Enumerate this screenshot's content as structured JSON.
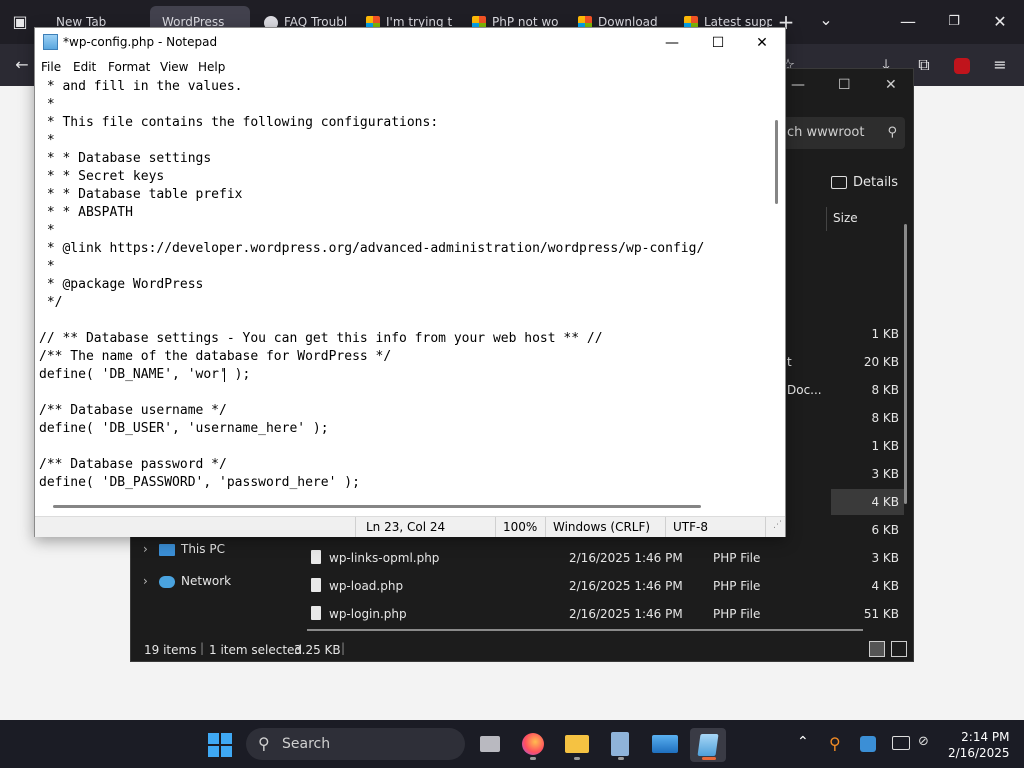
{
  "browser": {
    "tabs": [
      {
        "label": "New Tab",
        "active": false
      },
      {
        "label": "WordPress",
        "active": true
      },
      {
        "label": "FAQ Troubl",
        "active": false
      },
      {
        "label": "I'm trying t",
        "active": false
      },
      {
        "label": "PhP not wo",
        "active": false
      },
      {
        "label": "Download",
        "active": false
      },
      {
        "label": "Latest supp",
        "active": false
      }
    ],
    "new_tab_label": "+",
    "list_tabs_label": "⌄"
  },
  "explorer": {
    "search_placeholder": "ch wwwroot",
    "details_label": "Details",
    "size_header": "Size",
    "partial_names": [
      "t",
      "Doc..."
    ],
    "sizes": [
      "1 KB",
      "20 KB",
      "8 KB",
      "8 KB",
      "1 KB",
      "3 KB",
      "4 KB",
      "6 KB"
    ],
    "nav": [
      {
        "label": "This PC"
      },
      {
        "label": "Network"
      }
    ],
    "files": [
      {
        "name": "wp-links-opml.php",
        "date": "2/16/2025 1:46 PM",
        "type": "PHP File",
        "size": "3 KB"
      },
      {
        "name": "wp-load.php",
        "date": "2/16/2025 1:46 PM",
        "type": "PHP File",
        "size": "4 KB"
      },
      {
        "name": "wp-login.php",
        "date": "2/16/2025 1:46 PM",
        "type": "PHP File",
        "size": "51 KB"
      }
    ],
    "status": {
      "items": "19 items",
      "selected": "1 item selected",
      "selected_size": "3.25 KB"
    }
  },
  "notepad": {
    "title": "*wp-config.php - Notepad",
    "menu": [
      "File",
      "Edit",
      "Format",
      "View",
      "Help"
    ],
    "lines": [
      " * and fill in the values.",
      " *",
      " * This file contains the following configurations:",
      " *",
      " * * Database settings",
      " * * Secret keys",
      " * * Database table prefix",
      " * * ABSPATH",
      " *",
      " * @link https://developer.wordpress.org/advanced-administration/wordpress/wp-config/",
      " *",
      " * @package WordPress",
      " */",
      "",
      "// ** Database settings - You can get this info from your web host ** //",
      "/** The name of the database for WordPress */",
      "define( 'DB_NAME', 'wor' );",
      "",
      "/** Database username */",
      "define( 'DB_USER', 'username_here' );",
      "",
      "/** Database password */",
      "define( 'DB_PASSWORD', 'password_here' );"
    ],
    "status": {
      "position": "Ln 23, Col 24",
      "zoom": "100%",
      "line_ending": "Windows (CRLF)",
      "encoding": "UTF-8"
    }
  },
  "taskbar": {
    "search_label": "Search",
    "time": "2:14 PM",
    "date": "2/16/2025"
  },
  "colors": {
    "browser_chrome": "#2b2a33",
    "explorer_bg": "#1c1c1c",
    "taskbar_bg": "#1b1c25",
    "windows_accent": "#3fa9f5"
  }
}
